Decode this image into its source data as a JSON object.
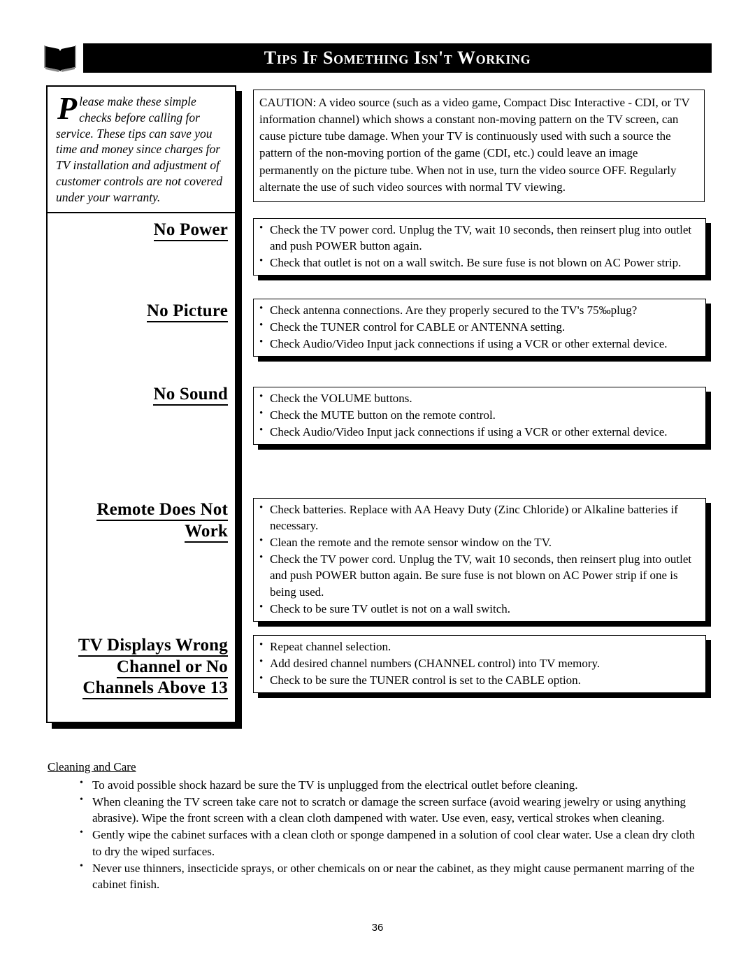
{
  "header": {
    "icon": "open-book-icon",
    "title": "Tips If Something Isn't Working"
  },
  "intro": {
    "dropcap": "P",
    "text": "lease make these simple checks before calling for service. These tips can save you time and money since charges for TV installation and adjustment of customer controls are not covered under your warranty."
  },
  "caution": {
    "text": "CAUTION: A video source (such as a video game, Compact Disc Interactive - CDI, or TV information channel) which shows a constant non-moving pattern on the TV screen, can cause picture tube damage.  When your TV is continuously used with such a source the pattern of the non-moving portion of the game (CDI, etc.) could leave an image permanently on the picture tube.  When not in use, turn the video source OFF. Regularly alternate the use of such video sources with normal TV viewing."
  },
  "sections": [
    {
      "heading": "No Power",
      "items": [
        "Check the TV power cord.  Unplug the TV, wait 10 seconds, then reinsert plug into outlet and push POWER button again.",
        "Check that outlet is not on a wall switch. Be sure fuse is not blown on AC Power strip."
      ]
    },
    {
      "heading": "No Picture",
      "items": [
        "Check antenna connections.  Are they properly secured to the TV's 75‰plug?",
        "Check the TUNER control for CABLE or ANTENNA setting.",
        "Check Audio/Video Input jack connections if using a VCR or other external device."
      ]
    },
    {
      "heading": "No Sound",
      "items": [
        "Check the VOLUME buttons.",
        "Check the MUTE button on the remote control.",
        "Check Audio/Video Input jack connections if using a VCR or other external device."
      ]
    },
    {
      "heading": "Remote Does Not Work",
      "items": [
        "Check batteries.  Replace with AA Heavy Duty (Zinc Chloride) or Alkaline batteries if necessary.",
        "Clean the remote and the remote sensor window on the TV.",
        "Check the TV power cord.  Unplug the TV, wait 10 seconds, then reinsert plug into outlet and push POWER button again. Be sure fuse is not blown on AC Power strip if one is being used.",
        "Check to be sure TV outlet is not on a wall switch."
      ]
    },
    {
      "heading": "TV Displays Wrong Channel or No Channels Above 13",
      "items": [
        "Repeat channel selection.",
        "Add desired channel numbers (CHANNEL control) into TV memory.",
        "Check to be sure the TUNER control is set to the CABLE option."
      ]
    }
  ],
  "care": {
    "title": "Cleaning and Care",
    "items": [
      "To avoid possible shock hazard be sure the TV is unplugged from the electrical outlet before cleaning.",
      "When cleaning the TV screen take care not to scratch or damage the screen surface (avoid wearing jewelry or using anything abrasive). Wipe the front screen with a clean cloth dampened with water. Use even, easy, vertical strokes when cleaning.",
      "Gently wipe the cabinet surfaces with a clean cloth or sponge dampened in a solution of cool clear water. Use a clean dry cloth to dry the wiped surfaces.",
      "Never use thinners, insecticide sprays, or other chemicals on or near the cabinet, as they might cause permanent marring of the cabinet finish."
    ]
  },
  "footer": {
    "page_number": "36"
  },
  "colors": {
    "ink": "#000000",
    "paper": "#ffffff",
    "header_bar": "#000000",
    "header_text": "#ffffff"
  }
}
